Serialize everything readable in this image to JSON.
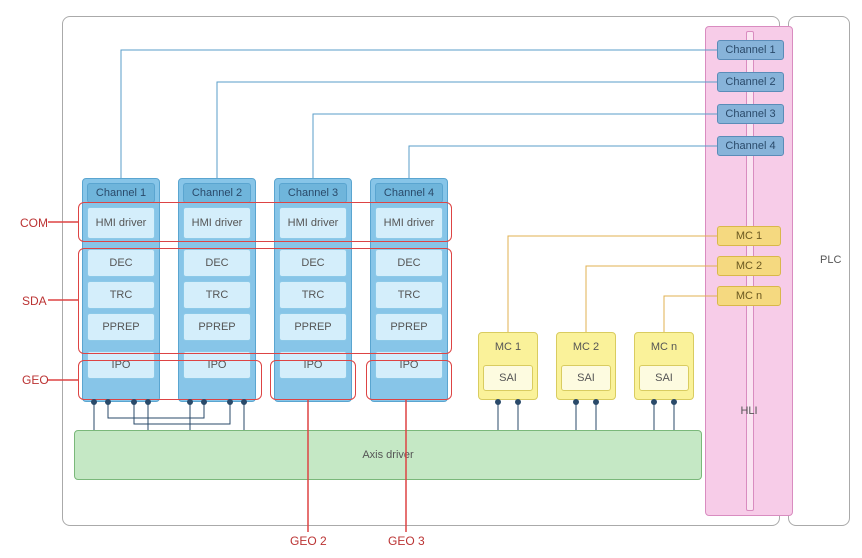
{
  "labels": {
    "plc": "PLC",
    "hli": "HLI",
    "com": "COM",
    "sda": "SDA",
    "geo": "GEO",
    "geo2": "GEO 2",
    "geo3": "GEO 3",
    "axis": "Axis driver"
  },
  "channels_right": [
    "Channel 1",
    "Channel 2",
    "Channel 3",
    "Channel 4"
  ],
  "channel_cols": [
    {
      "name": "Channel 1",
      "hmi": "HMI driver",
      "dec": "DEC",
      "trc": "TRC",
      "pprep": "PPREP",
      "ipo": "IPO"
    },
    {
      "name": "Channel 2",
      "hmi": "HMI driver",
      "dec": "DEC",
      "trc": "TRC",
      "pprep": "PPREP",
      "ipo": "IPO"
    },
    {
      "name": "Channel 3",
      "hmi": "HMI driver",
      "dec": "DEC",
      "trc": "TRC",
      "pprep": "PPREP",
      "ipo": "IPO"
    },
    {
      "name": "Channel 4",
      "hmi": "HMI driver",
      "dec": "DEC",
      "trc": "TRC",
      "pprep": "PPREP",
      "ipo": "IPO"
    }
  ],
  "mc_cols": [
    {
      "name": "MC 1",
      "sai": "SAI"
    },
    {
      "name": "MC 2",
      "sai": "SAI"
    },
    {
      "name": "MC n",
      "sai": "SAI"
    }
  ],
  "mc_right": [
    "MC 1",
    "MC 2",
    "MC n"
  ]
}
